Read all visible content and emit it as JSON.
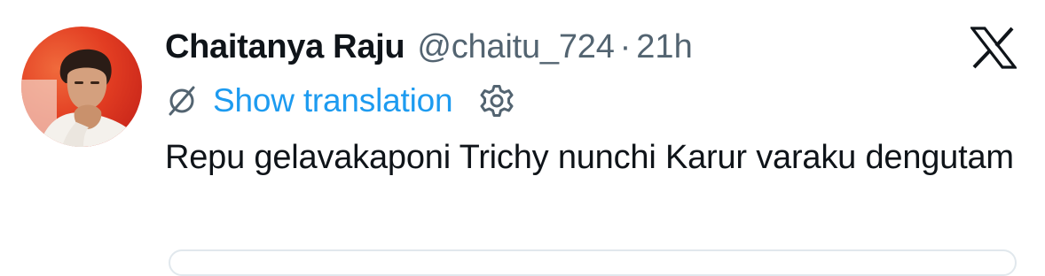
{
  "tweet": {
    "author": {
      "display_name": "Chaitanya Raju",
      "handle": "@chaitu_724",
      "avatar_icon": "avatar"
    },
    "separator": "·",
    "timestamp": "21h",
    "translation": {
      "icon": "globe-icon",
      "label": "Show translation",
      "settings_icon": "gear-icon"
    },
    "text": "Repu gelavakaponi Trichy nunchi Karur varaku dengutam",
    "platform_icon": "x-logo-icon"
  },
  "colors": {
    "text_primary": "#0f1419",
    "text_secondary": "#536471",
    "link": "#1d9bf0"
  }
}
